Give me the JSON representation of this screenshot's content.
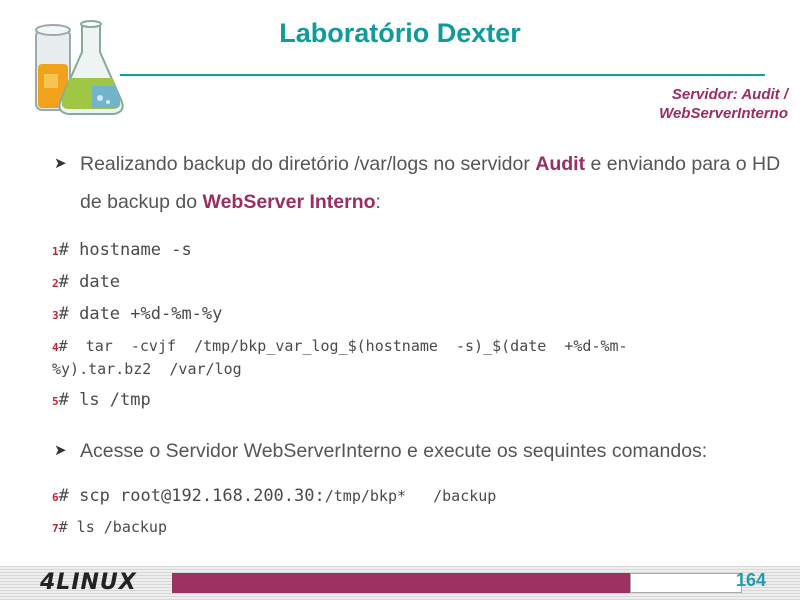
{
  "header": {
    "title": "Laboratório Dexter",
    "server_line1": "Servidor: Audit /",
    "server_line2": "WebServerInterno"
  },
  "bullet1": {
    "pre": "Realizando backup do diretório /var/logs no servidor ",
    "hl1": "Audit",
    "mid": " e enviando para o HD de backup do ",
    "hl2": "WebServer Interno",
    "post": ":"
  },
  "commands": [
    {
      "num": "1",
      "text": "# hostname -s"
    },
    {
      "num": "2",
      "text": "# date"
    },
    {
      "num": "3",
      "text": "# date +%d-%m-%y"
    },
    {
      "num": "4",
      "text": "#  tar  -cvjf  /tmp/bkp_var_log_$(hostname  -s)_$(date  +%d-%m-",
      "cont": "%y).tar.bz2  /var/log"
    },
    {
      "num": "5",
      "text": "# ls /tmp"
    }
  ],
  "bullet2": {
    "text": "Acesse o Servidor WebServerInterno e execute os sequintes comandos:"
  },
  "commands2": [
    {
      "num": "6",
      "text": "# scp root@192.168.200.30:",
      "text_small": "/tmp/bkp*   /backup"
    },
    {
      "num": "7",
      "text": "# ls /backup"
    }
  ],
  "footer": {
    "brand": "4LINUX",
    "page_number": "164"
  },
  "colors": {
    "title": "#0f9b9b",
    "highlight": "#9b2d63",
    "bar": "#9c3262",
    "page_number": "#1f9bb0"
  }
}
